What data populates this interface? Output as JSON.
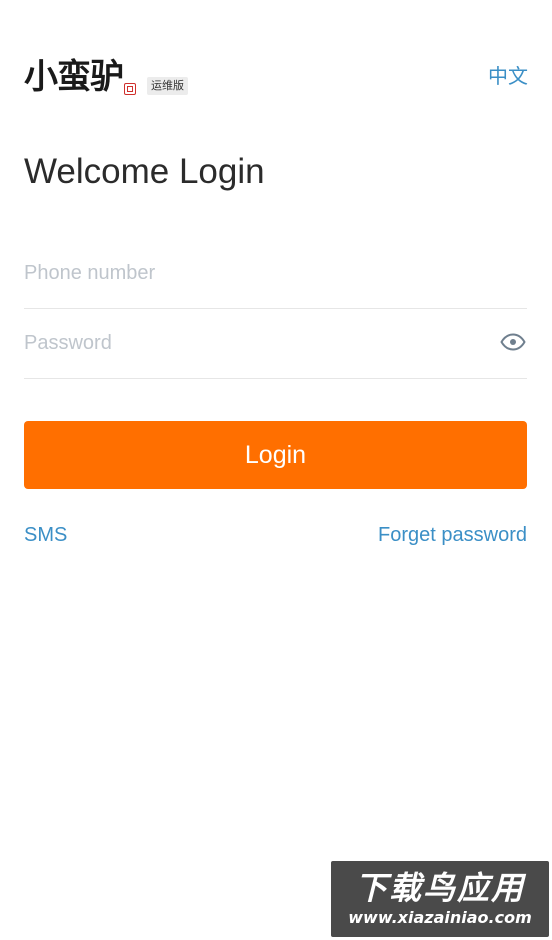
{
  "header": {
    "logo_text": "小蛮驴",
    "edition_badge": "运维版",
    "language_link": "中文"
  },
  "title": "Welcome Login",
  "form": {
    "phone": {
      "placeholder": "Phone number",
      "value": ""
    },
    "password": {
      "placeholder": "Password",
      "value": ""
    },
    "password_toggle_icon": "eye-icon",
    "login_label": "Login"
  },
  "links": {
    "sms": "SMS",
    "forgot_password": "Forget password"
  },
  "watermark": {
    "title": "下载鸟应用",
    "url": "www.xiazainiao.com"
  },
  "colors": {
    "accent": "#ff6f00",
    "link": "#3b8fc6",
    "placeholder": "#bfc5cc",
    "divider": "#e6e6e6"
  }
}
